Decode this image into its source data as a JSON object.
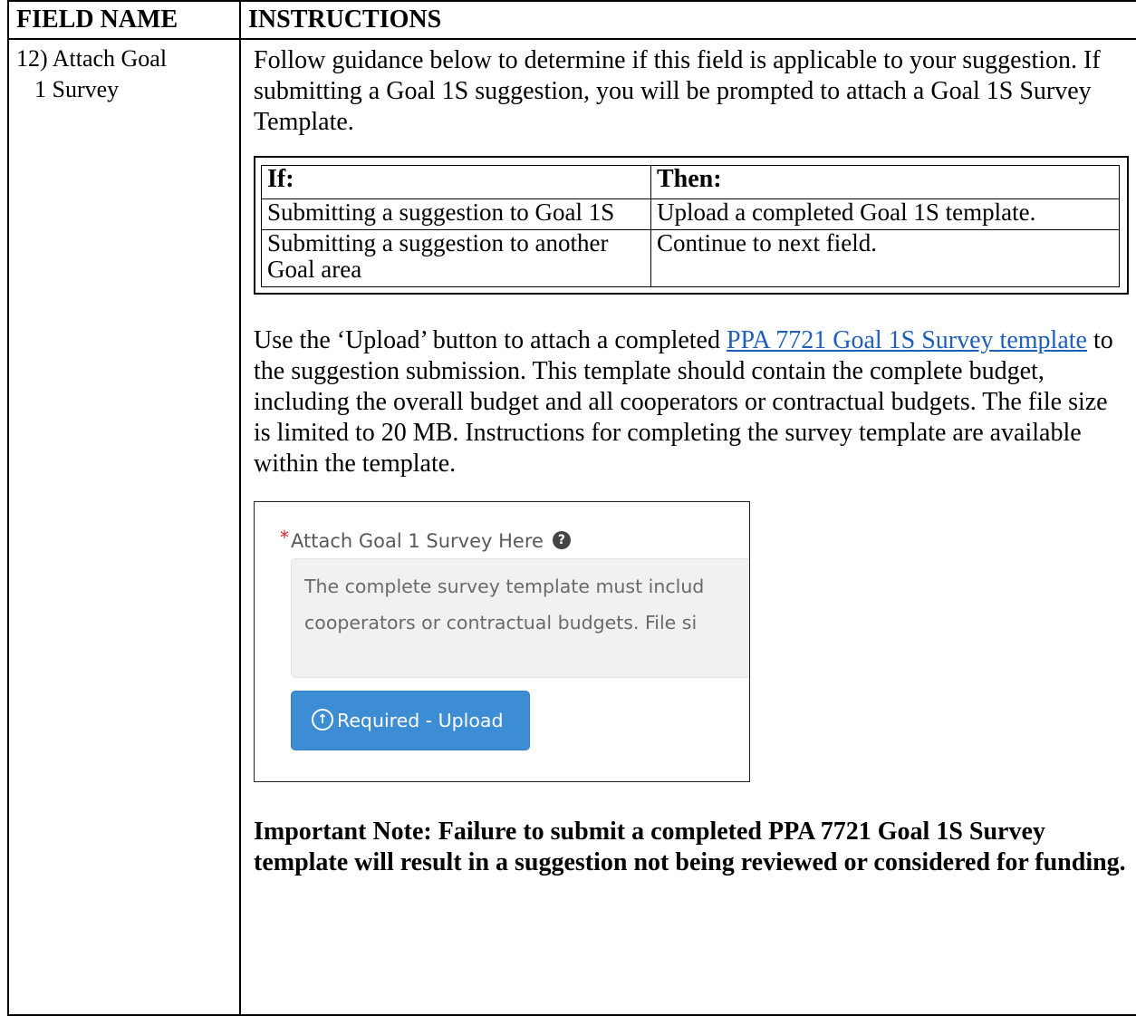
{
  "header": {
    "col1": "FIELD NAME",
    "col2": "INSTRUCTIONS"
  },
  "field": {
    "line1": "12) Attach Goal",
    "line2": "1 Survey"
  },
  "intro": "Follow guidance below to determine if this field is applicable to your suggestion. If submitting a Goal 1S suggestion, you will be prompted to attach a Goal 1S Survey Template.",
  "decision_table": {
    "header_if": "If:",
    "header_then": "Then:",
    "rows": [
      {
        "if": "Submitting a suggestion to Goal 1S",
        "then": "Upload a completed Goal 1S template."
      },
      {
        "if": "Submitting a suggestion to another Goal area",
        "then": "Continue to next field."
      }
    ]
  },
  "upload_para": {
    "before": "Use the ‘Upload’ button to attach a completed ",
    "link": "PPA 7721 Goal 1S Survey template",
    "after": " to the suggestion submission. This template should contain the complete budget, including the overall budget and all cooperators or contractual budgets. The file size is limited to 20 MB. Instructions for completing the survey template are available within the template."
  },
  "screenshot": {
    "required_mark": "*",
    "label": "Attach Goal 1 Survey Here",
    "help_icon": "?",
    "box_line1": "The complete survey template must includ",
    "box_line2": "cooperators or contractual budgets. File si",
    "button_icon": "↑",
    "button_label": "Required - Upload"
  },
  "note": "Important Note: Failure to submit a completed PPA 7721 Goal 1S Survey template will result in a suggestion not being reviewed or considered for funding."
}
